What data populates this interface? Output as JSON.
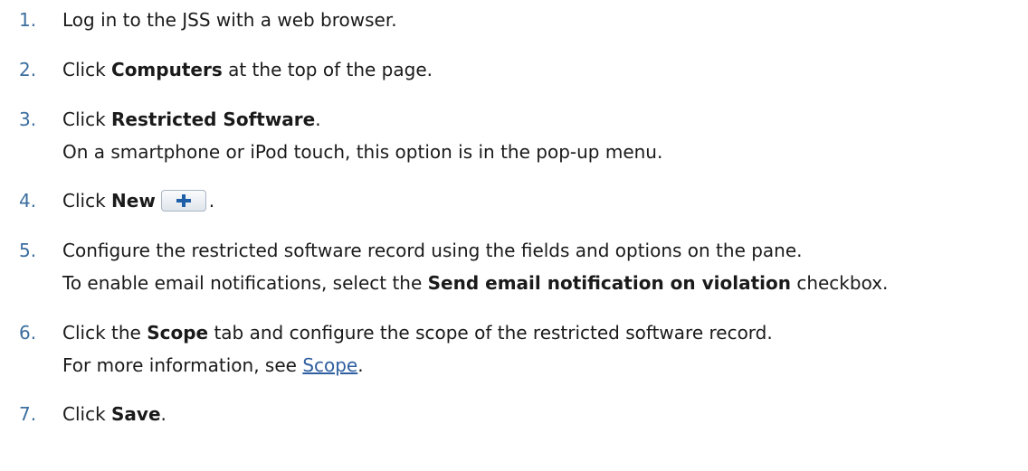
{
  "steps": [
    {
      "number": "1.",
      "text": "Log in to the JSS with a web browser."
    },
    {
      "number": "2.",
      "before": "Click ",
      "bold": "Computers",
      "after": " at the top of the page."
    },
    {
      "number": "3.",
      "before": "Click ",
      "bold": "Restricted Software",
      "after": ".",
      "note": "On a smartphone or iPod touch, this option is in the pop-up menu."
    },
    {
      "number": "4.",
      "before": "Click ",
      "bold": "New",
      "after": ".",
      "icon": "plus-icon",
      "icon_color": "#1f5fa8"
    },
    {
      "number": "5.",
      "text": "Configure the restricted software record using the fields and options on the pane.",
      "note_before": "To enable email notifications, select the ",
      "note_bold": "Send email notification on violation",
      "note_after": " checkbox."
    },
    {
      "number": "6.",
      "before": "Click the ",
      "bold": "Scope",
      "after": " tab and configure the scope of the restricted software record.",
      "note_before": "For more information, see ",
      "note_link": "Scope",
      "note_after": "."
    },
    {
      "number": "7.",
      "before": "Click ",
      "bold": "Save",
      "after": "."
    }
  ]
}
